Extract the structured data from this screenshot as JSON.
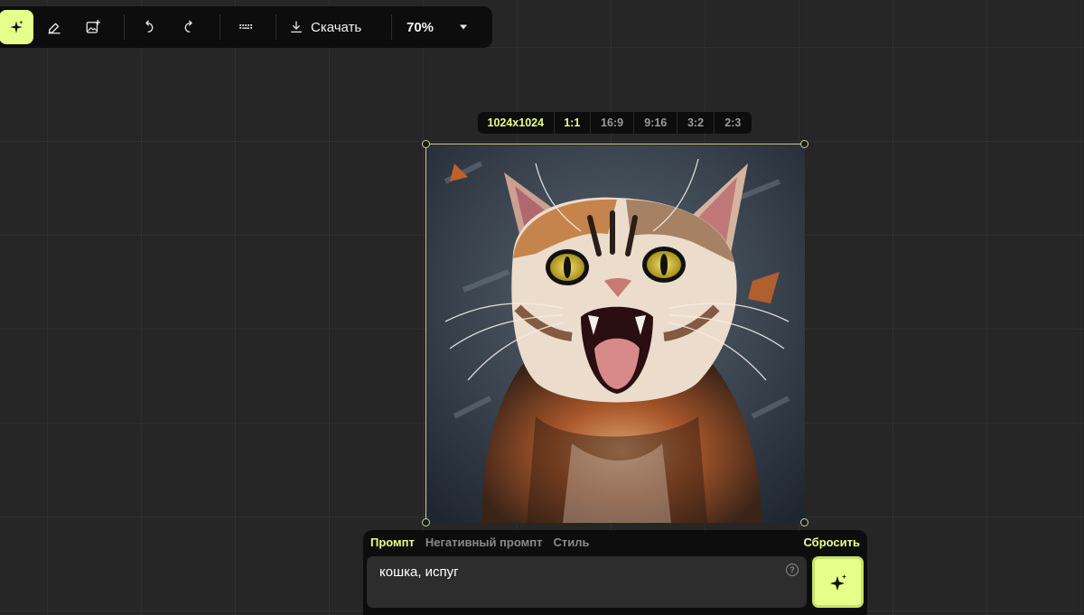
{
  "toolbar": {
    "tools": [
      {
        "name": "generate-tool",
        "icon": "sparkle-icon",
        "active": true
      },
      {
        "name": "eraser-tool",
        "icon": "eraser-icon",
        "active": false
      },
      {
        "name": "add-image-tool",
        "icon": "image-add-icon",
        "active": false
      }
    ],
    "download_label": "Скачать",
    "zoom": "70%"
  },
  "ratio_bar": {
    "resolution": "1024x1024",
    "options": [
      "1:1",
      "16:9",
      "9:16",
      "3:2",
      "2:3"
    ],
    "selected": "1:1"
  },
  "prompt_panel": {
    "tabs": [
      "Промпт",
      "Негативный промпт",
      "Стиль"
    ],
    "active_tab": "Промпт",
    "reset_label": "Сбросить",
    "prompt_value": "кошка, испуг",
    "help_glyph": "?"
  },
  "colors": {
    "accent": "#e6ff8a",
    "background": "#262626",
    "panel": "#0d0d0d"
  }
}
